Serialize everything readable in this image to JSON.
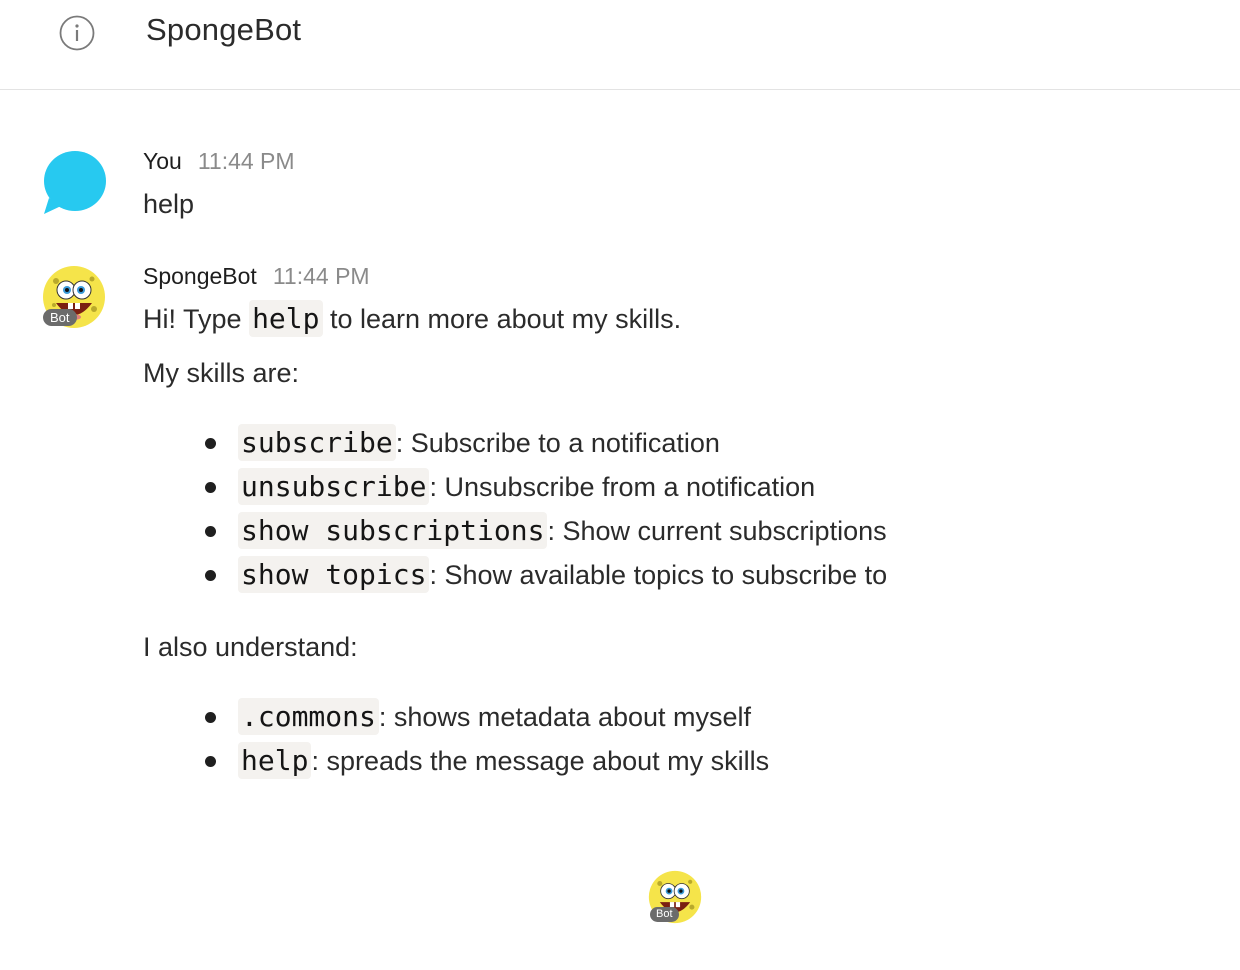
{
  "header": {
    "info_icon": "info-icon",
    "title": "SpongeBot"
  },
  "messages": [
    {
      "author": "You",
      "time": "11:44 PM",
      "text": "help",
      "avatar_icon": "chat-bubble-icon",
      "avatar_color": "#27c9f0"
    },
    {
      "author": "SpongeBot",
      "time": "11:44 PM",
      "intro_before": "Hi! Type ",
      "intro_code": "help",
      "intro_after": " to learn more about my skills.",
      "skills_heading": "My skills are:",
      "skills": [
        {
          "command": "subscribe",
          "sep": ": ",
          "description": "Subscribe to a notification"
        },
        {
          "command": "unsubscribe",
          "sep": ": ",
          "description": "Unsubscribe from a notification"
        },
        {
          "command": "show subscriptions",
          "sep": ": ",
          "description": "Show current subscriptions"
        },
        {
          "command": "show topics",
          "sep": ": ",
          "description": "Show available topics to subscribe to"
        }
      ],
      "also_heading": "I also understand:",
      "also": [
        {
          "command": ".commons",
          "sep": ": ",
          "description": "shows metadata about myself"
        },
        {
          "command": "help",
          "sep": ": ",
          "description": "spreads the message about my skills"
        }
      ],
      "avatar_icon": "spongebob-avatar-icon",
      "badge": "Bot"
    }
  ],
  "typing_indicator": {
    "avatar_icon": "spongebob-avatar-icon",
    "badge": "Bot"
  },
  "colors": {
    "bubble": "#27c9f0",
    "code_bg": "#f4f2ef",
    "time": "#8a8a8a",
    "divider": "#e3e3e3",
    "sponge": "#f5e44a"
  }
}
